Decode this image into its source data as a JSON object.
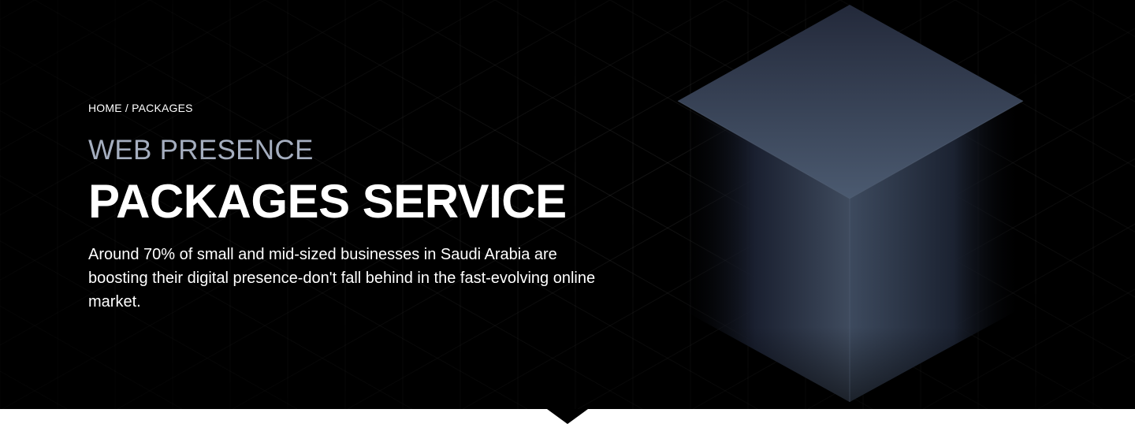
{
  "breadcrumb": {
    "home": "HOME",
    "separator": " / ",
    "current": "PACKAGES"
  },
  "hero": {
    "eyebrow": "WEB PRESENCE",
    "title": "PACKAGES SERVICE",
    "description": "Around 70% of small and mid-sized businesses in Saudi Arabia are boosting their digital presence-don't fall behind in the fast-evolving online market."
  },
  "colors": {
    "background": "#000000",
    "eyebrow": "#a5aebf",
    "text": "#ffffff",
    "cube": "#4a5568"
  },
  "icons": {
    "decor": "isometric-cube-graphic",
    "pointer": "down-pointer-notch"
  }
}
